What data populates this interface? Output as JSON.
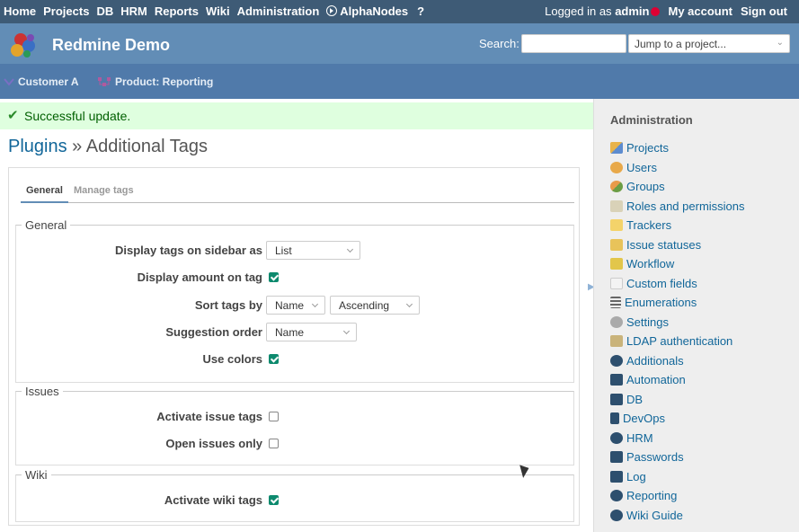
{
  "top_menu": {
    "left": [
      "Home",
      "Projects",
      "DB",
      "HRM",
      "Reports",
      "Wiki",
      "Administration",
      "AlphaNodes"
    ],
    "logged_in_prefix": "Logged in as",
    "user": "admin",
    "my_account": "My account",
    "sign_out": "Sign out",
    "help": "?"
  },
  "header": {
    "title": "Redmine Demo",
    "search_label": "Search:",
    "search_value": "",
    "jump_placeholder": "Jump to a project...",
    "jump_chevron": "⌄"
  },
  "project_bar": {
    "items": [
      "Customer A",
      "Product: Reporting"
    ]
  },
  "flash": {
    "icon": "✔",
    "message": "Successful update."
  },
  "title": {
    "crumb": "Plugins",
    "sep": " » ",
    "page": "Additional Tags"
  },
  "tabs": [
    {
      "label": "General",
      "active": true
    },
    {
      "label": "Manage tags",
      "active": false
    }
  ],
  "fieldsets": {
    "general": {
      "legend": "General",
      "display_on_sidebar_label": "Display tags on sidebar as",
      "display_on_sidebar_value": "List",
      "display_amount_label": "Display amount on tag",
      "display_amount_checked": true,
      "sort_label": "Sort tags by",
      "sort_field": "Name",
      "sort_direction": "Ascending",
      "suggestion_label": "Suggestion order",
      "suggestion_value": "Name",
      "use_colors_label": "Use colors",
      "use_colors_checked": true
    },
    "issues": {
      "legend": "Issues",
      "activate_label": "Activate issue tags",
      "activate_checked": false,
      "open_only_label": "Open issues only",
      "open_only_checked": false
    },
    "wiki": {
      "legend": "Wiki",
      "activate_label": "Activate wiki tags",
      "activate_checked": true
    }
  },
  "sidebar": {
    "heading": "Administration",
    "items": [
      {
        "label": "Projects",
        "icon": "projects-icon"
      },
      {
        "label": "Users",
        "icon": "users-icon"
      },
      {
        "label": "Groups",
        "icon": "groups-icon"
      },
      {
        "label": "Roles and permissions",
        "icon": "roles-icon"
      },
      {
        "label": "Trackers",
        "icon": "trackers-icon"
      },
      {
        "label": "Issue statuses",
        "icon": "issue-statuses-icon"
      },
      {
        "label": "Workflow",
        "icon": "workflow-icon"
      },
      {
        "label": "Custom fields",
        "icon": "custom-fields-icon"
      },
      {
        "label": "Enumerations",
        "icon": "enumerations-icon"
      },
      {
        "label": "Settings",
        "icon": "settings-icon"
      },
      {
        "label": "LDAP authentication",
        "icon": "ldap-icon"
      },
      {
        "label": "Additionals",
        "icon": "gears-icon"
      },
      {
        "label": "Automation",
        "icon": "robot-icon"
      },
      {
        "label": "DB",
        "icon": "database-icon"
      },
      {
        "label": "DevOps",
        "icon": "branch-icon"
      },
      {
        "label": "HRM",
        "icon": "user-circle-icon"
      },
      {
        "label": "Passwords",
        "icon": "shield-icon"
      },
      {
        "label": "Log",
        "icon": "book-icon"
      },
      {
        "label": "Reporting",
        "icon": "pie-chart-icon"
      },
      {
        "label": "Wiki Guide",
        "icon": "globe-icon"
      }
    ]
  }
}
